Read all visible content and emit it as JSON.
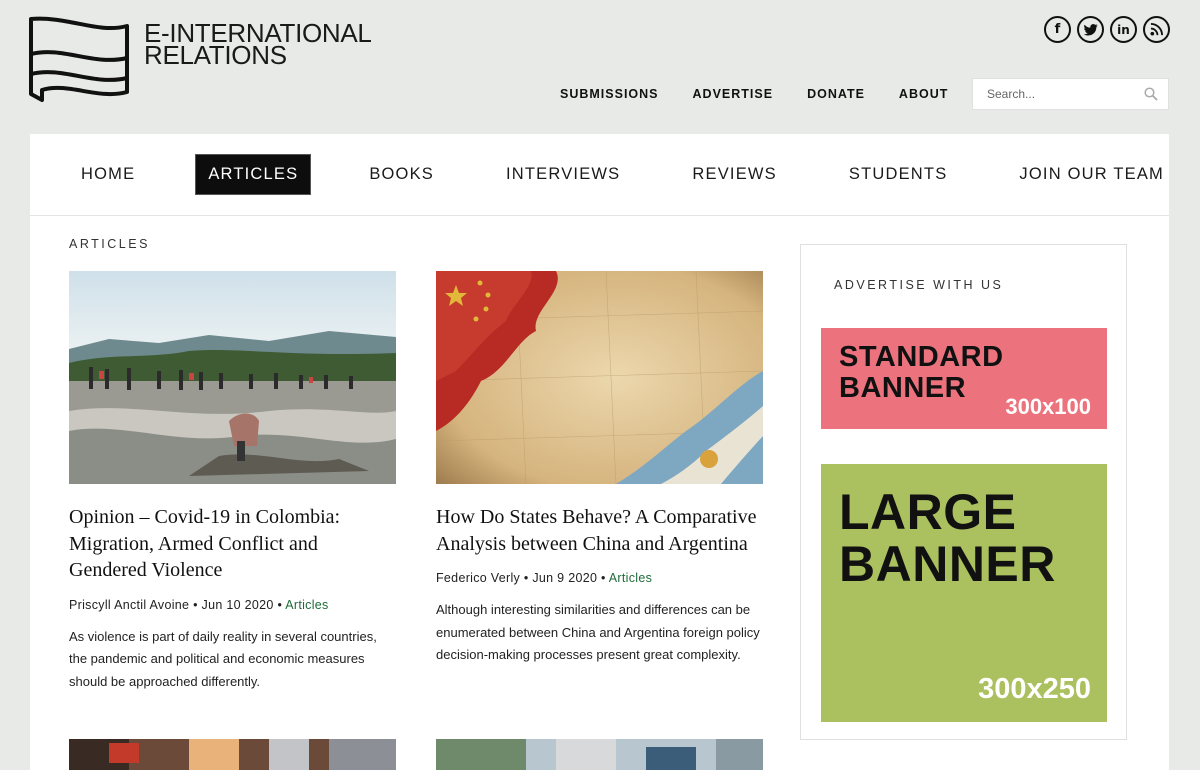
{
  "site": {
    "name_line1": "E-INTERNATIONAL",
    "name_line2": "RELATIONS"
  },
  "social": [
    {
      "icon": "facebook-icon",
      "glyph": "f"
    },
    {
      "icon": "twitter-icon",
      "glyph": "t"
    },
    {
      "icon": "linkedin-icon",
      "glyph": "in"
    },
    {
      "icon": "rss-icon",
      "glyph": "))"
    }
  ],
  "topnav": [
    "SUBMISSIONS",
    "ADVERTISE",
    "DONATE",
    "ABOUT"
  ],
  "search": {
    "placeholder": "Search..."
  },
  "mainnav": [
    "HOME",
    "ARTICLES",
    "BOOKS",
    "INTERVIEWS",
    "REVIEWS",
    "STUDENTS",
    "JOIN OUR TEAM"
  ],
  "mainnav_active": "ARTICLES",
  "section": {
    "label": "ARTICLES"
  },
  "articles": [
    {
      "title": "Opinion – Covid-19 in Colombia: Migration, Armed Conflict and Gendered Violence",
      "author": "Priscyll Anctil Avoine",
      "date": "Jun 10 2020",
      "category": "Articles",
      "excerpt": "As violence is part of daily reality in several countries, the pandemic and political and economic measures should be approached differently."
    },
    {
      "title": "How Do States Behave? A Comparative Analysis between China and Argentina",
      "author": "Federico Verly",
      "date": "Jun 9 2020",
      "category": "Articles",
      "excerpt": "Although interesting similarities and differences can be enumerated between China and Argentina foreign policy decision-making processes present great complexity."
    }
  ],
  "sidebar": {
    "label": "ADVERTISE WITH US",
    "standard": {
      "line1": "STANDARD",
      "line2": "BANNER",
      "size": "300x100"
    },
    "large": {
      "line1": "LARGE",
      "line2": "BANNER",
      "size": "300x250"
    }
  },
  "colors": {
    "background": "#e8eae7",
    "category_link": "#1f6b3a",
    "standard_banner": "#ec737d",
    "large_banner": "#abc05e"
  }
}
